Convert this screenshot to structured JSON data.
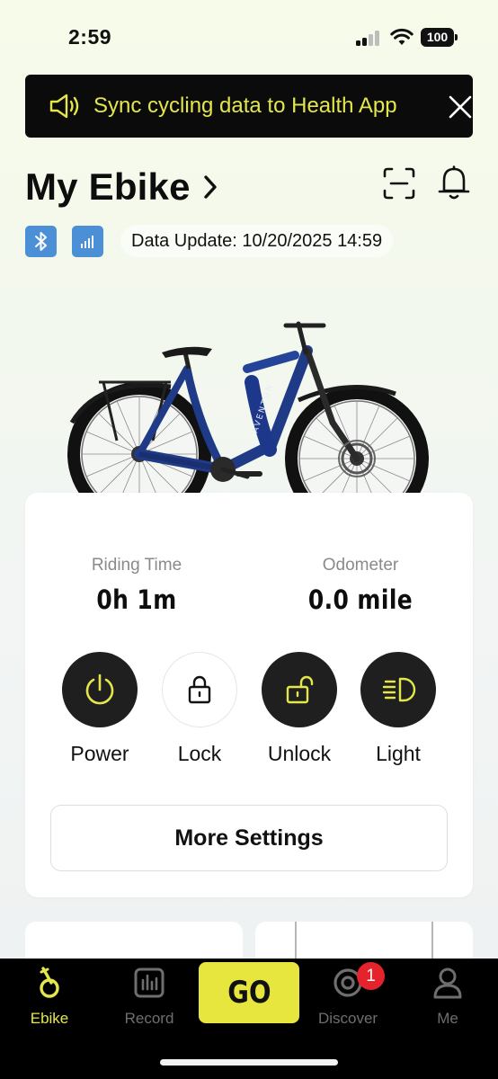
{
  "status_bar": {
    "time": "2:59",
    "battery": "100"
  },
  "banner": {
    "text": "Sync cycling data to Health App"
  },
  "header": {
    "title": "My Ebike"
  },
  "data_update": "Data Update: 10/20/2025 14:59",
  "bike": {
    "brand_text": "AVENTON"
  },
  "stats": [
    {
      "label": "Riding Time",
      "value": "0h  1m"
    },
    {
      "label": "Odometer",
      "value": "0.0 mile"
    }
  ],
  "controls": [
    {
      "label": "Power",
      "icon": "power-icon"
    },
    {
      "label": "Lock",
      "icon": "lock-icon"
    },
    {
      "label": "Unlock",
      "icon": "unlock-icon"
    },
    {
      "label": "Light",
      "icon": "headlight-icon"
    }
  ],
  "more_settings_label": "More Settings",
  "tabbar": {
    "tabs": [
      {
        "label": "Ebike",
        "icon": "ebike-icon",
        "active": true
      },
      {
        "label": "Record",
        "icon": "record-icon",
        "active": false
      },
      {
        "label": "Discover",
        "icon": "discover-icon",
        "active": false
      },
      {
        "label": "Me",
        "icon": "profile-icon",
        "active": false
      }
    ],
    "go_label": "GO",
    "discover_badge": "1"
  },
  "colors": {
    "accent": "#e4e64c",
    "dark": "#1f1f1f",
    "badge_blue": "#4b8fd6",
    "notif_red": "#e5232d"
  }
}
